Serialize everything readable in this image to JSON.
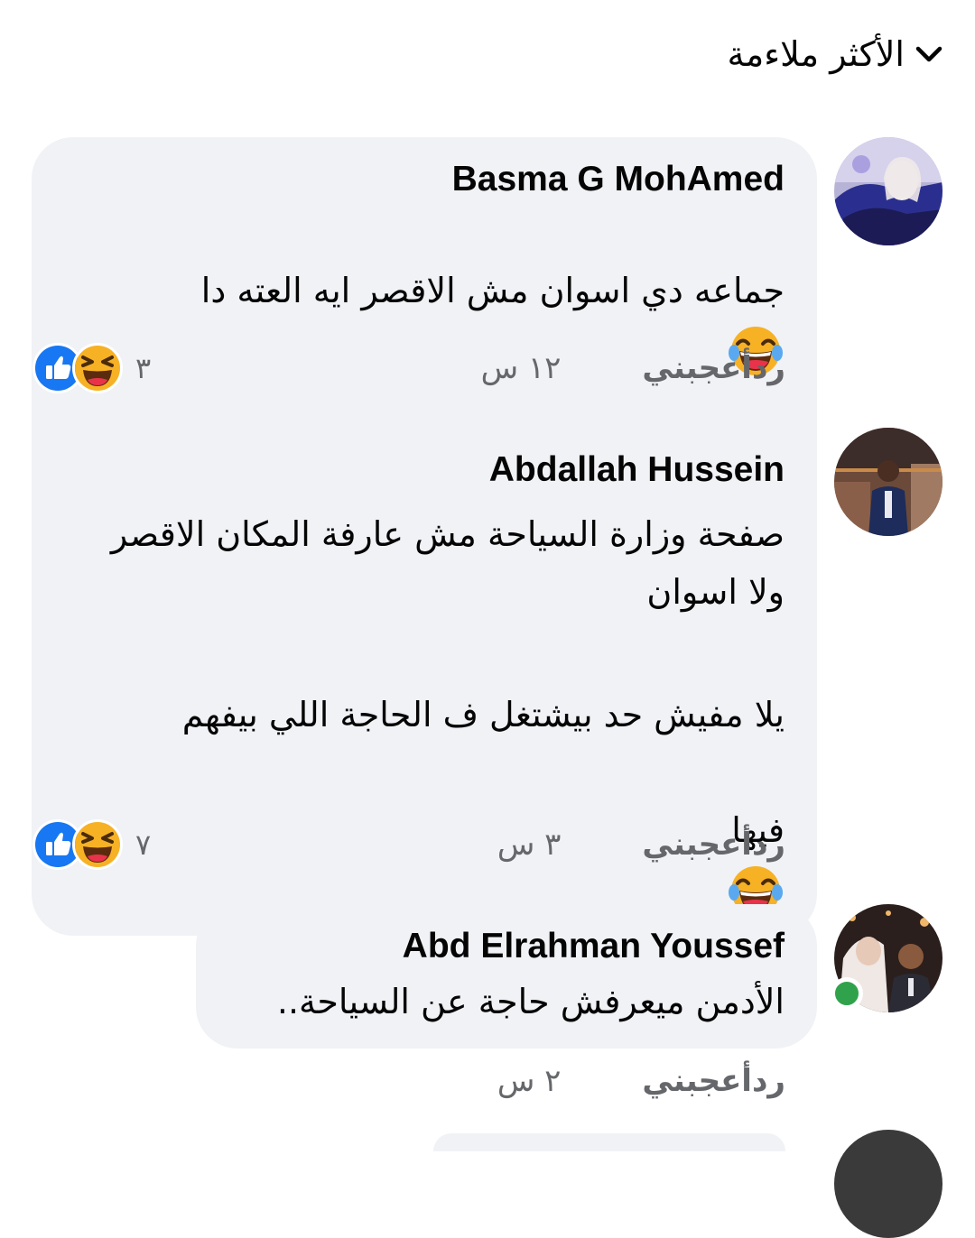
{
  "sort": {
    "label": "الأكثر ملاءمة",
    "icon": "chevron-down-icon"
  },
  "colors": {
    "bubble_bg": "#f0f2f5",
    "meta_text": "#65676b",
    "like_blue": "#1877f2",
    "haha_yellow": "#f7b125",
    "online_green": "#31a24c"
  },
  "comments": [
    {
      "author": "Basma G MohAmed",
      "text_line1": "جماعه دي اسوان مش الاقصر ايه العته دا",
      "time": "١٢ س",
      "like_label": "أعجبني",
      "reply_label": "رد",
      "reaction_count": "٣",
      "reactions": [
        "haha-icon",
        "like-icon"
      ],
      "emoji": "laughing-tears-emoji"
    },
    {
      "author": "Abdallah Hussein",
      "text_line1": "صفحة وزارة السياحة مش عارفة المكان الاقصر",
      "text_line2": "ولا اسوان",
      "text_line3": "يلا مفيش حد بيشتغل ف الحاجة اللي بيفهم",
      "text_line4": "فيها",
      "time": "٣ س",
      "like_label": "أعجبني",
      "reply_label": "رد",
      "reaction_count": "٧",
      "reactions": [
        "haha-icon",
        "like-icon"
      ],
      "emoji": "laughing-tears-emoji"
    },
    {
      "author": "Abd Elrahman Youssef",
      "text_line1": "الأدمن ميعرفش حاجة عن السياحة..",
      "time": "٢ س",
      "like_label": "أعجبني",
      "reply_label": "رد",
      "online": true
    }
  ]
}
